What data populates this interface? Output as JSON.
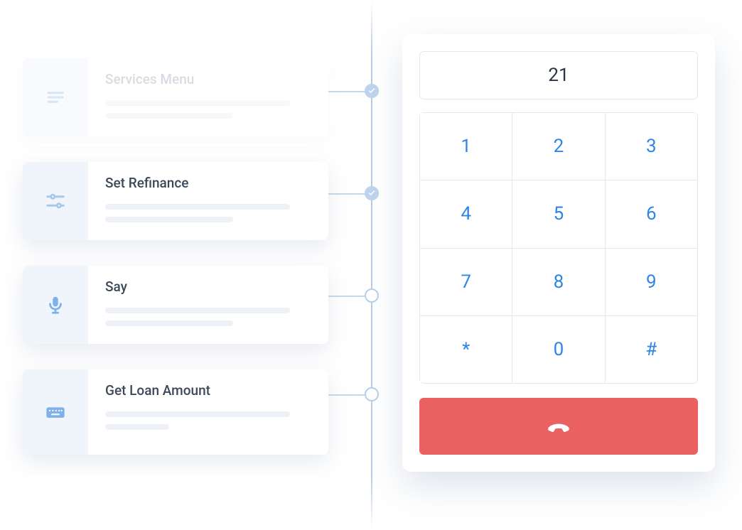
{
  "flow": {
    "items": [
      {
        "title": "Services Menu",
        "icon": "menu-icon",
        "completed": true,
        "faded": true
      },
      {
        "title": "Set Refinance",
        "icon": "sliders-icon",
        "completed": true,
        "faded": false
      },
      {
        "title": "Say",
        "icon": "mic-icon",
        "completed": false,
        "faded": false
      },
      {
        "title": "Get Loan Amount",
        "icon": "keyboard-icon",
        "completed": false,
        "faded": false
      }
    ]
  },
  "dialpad": {
    "display": "21",
    "keys": [
      "1",
      "2",
      "3",
      "4",
      "5",
      "6",
      "7",
      "8",
      "9",
      "*",
      "0",
      "#"
    ],
    "hangup_label": "Hang up"
  },
  "colors": {
    "accent_blue": "#2f86e4",
    "icon_blue": "#a8c7ea",
    "hangup_red": "#eb6060",
    "card_icon_bg": "#f0f5fc",
    "text_dark": "#3c4858"
  }
}
